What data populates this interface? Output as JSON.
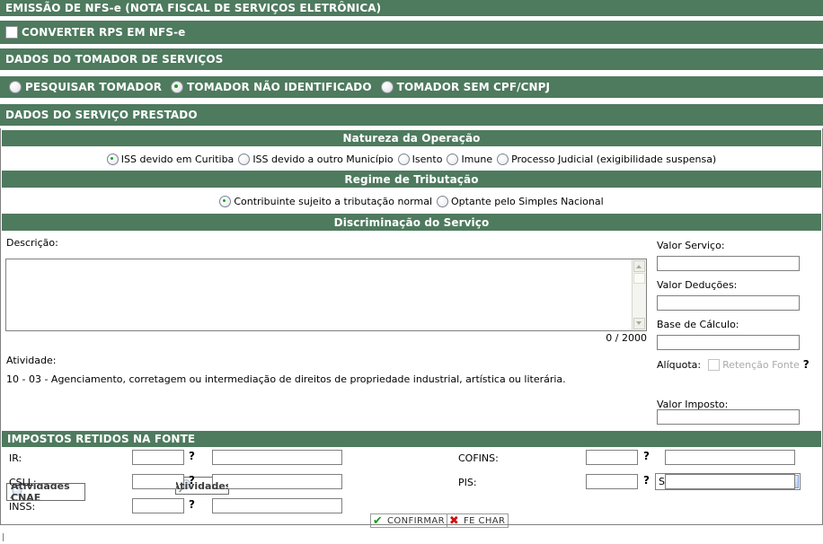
{
  "title": "EMISSÃO DE NFS-e (NOTA FISCAL DE SERVIÇOS ELETRÔNICA)",
  "converter": {
    "label": "CONVERTER RPS EM NFS-e",
    "checked": false
  },
  "sections": {
    "tomador_header": "DADOS DO TOMADOR DE SERVIÇOS",
    "servico_header": "DADOS DO SERVIÇO PRESTADO",
    "natureza_header": "Natureza da Operação",
    "regime_header": "Regime de Tributação",
    "discriminacao_header": "Discriminação do Serviço",
    "impostos_header": "IMPOSTOS RETIDOS NA FONTE"
  },
  "tomador_options": [
    {
      "label": "PESQUISAR TOMADOR",
      "checked": false
    },
    {
      "label": "TOMADOR NÃO IDENTIFICADO",
      "checked": true
    },
    {
      "label": "TOMADOR SEM CPF/CNPJ",
      "checked": false
    }
  ],
  "natureza_options": [
    {
      "label": "ISS devido em Curitiba",
      "checked": true
    },
    {
      "label": "ISS devido a outro Município",
      "checked": false
    },
    {
      "label": "Isento",
      "checked": false
    },
    {
      "label": "Imune",
      "checked": false
    },
    {
      "label": "Processo Judicial (exigibilidade suspensa)",
      "checked": false
    }
  ],
  "regime_options": [
    {
      "label": "Contribuinte sujeito a tributação normal",
      "checked": true
    },
    {
      "label": "Optante pelo Simples Nacional",
      "checked": false
    }
  ],
  "discriminacao": {
    "descricao_label": "Descrição:",
    "descricao_value": "",
    "descricao_placeholder": "",
    "counter": "0 / 2000",
    "atividade_label": "Atividade:",
    "atividade_value": "10 - 03 - Agenciamento, corretagem ou intermediação de direitos de propriedade industrial, artística ou literária.",
    "btn_cnae": "Atividades CNAE",
    "btn_atividades": "Atividades",
    "btn_cnae_icon": "magnifier-icon",
    "btn_atividades_icon": "magnifier-icon"
  },
  "valores": {
    "valor_servico_label": "Valor Serviço:",
    "valor_servico_value": "",
    "valor_deducoes_label": "Valor Deduções:",
    "valor_deducoes_value": "",
    "base_calculo_label": "Base de Cálculo:",
    "base_calculo_value": "",
    "aliquota_label": "Alíquota:",
    "retencao_label": "Retenção Fonte",
    "retencao_checked": false,
    "retencao_disabled": true,
    "help_mark": "?",
    "aliquota_selected": "Selecione",
    "aliquota_options": [
      "Selecione"
    ],
    "valor_imposto_label": "Valor Imposto:",
    "valor_imposto_value": ""
  },
  "impostos": [
    {
      "label": "IR:",
      "value": "",
      "help": "?",
      "extra": ""
    },
    {
      "label": "CSLL:",
      "value": "",
      "help": "?",
      "extra": ""
    },
    {
      "label": "INSS:",
      "value": "",
      "help": "?",
      "extra": ""
    },
    {
      "label": "COFINS:",
      "value": "",
      "help": "?",
      "extra": ""
    },
    {
      "label": "PIS:",
      "value": "",
      "help": "?",
      "extra": ""
    }
  ],
  "actions": {
    "confirm_label": "CONFIRMAR",
    "confirm_icon": "check-icon",
    "close_label": "FE CHAR",
    "close_icon": "x-icon"
  },
  "colors": {
    "bar_green": "#4e7a5e",
    "radio_dot_green": "#14a11e",
    "confirm_green": "#1a9c1a",
    "close_red": "#cc1111",
    "border_gray": "#7f7f7f"
  }
}
